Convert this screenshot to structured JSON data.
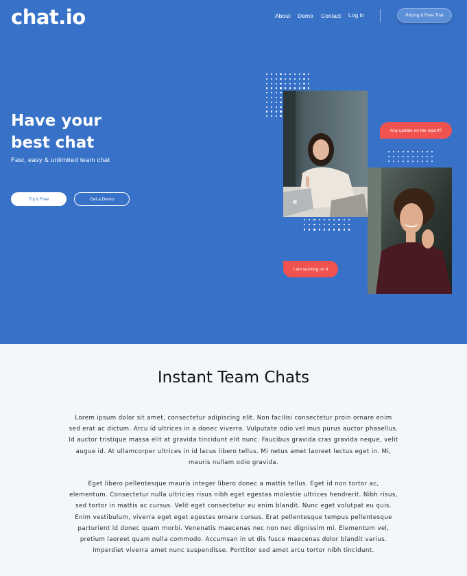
{
  "brand": {
    "logo_text": "chat.io",
    "accent": "#3872c8",
    "bubble_color": "#f0524f"
  },
  "nav": {
    "items": [
      "About",
      "Demo",
      "Contact",
      "Log in"
    ],
    "cta": "Pricing & Free Trial"
  },
  "hero": {
    "headline_line1": "Have your",
    "headline_line2": "best chat",
    "subline": "Fast, easy & unlimited team chat",
    "primary_button": "Try it Free",
    "secondary_button": "Get a Demo",
    "bubble_top": "Any update on the report?",
    "bubble_bottom": "I am working on it"
  },
  "section": {
    "title": "Instant Team Chats",
    "paragraph1": "Lorem ipsum dolor sit amet, consectetur adipiscing elit. Non facilisi consectetur proin ornare enim sed erat ac dictum. Arcu id ultrices in a donec viverra. Vulputate odio vel mus purus auctor phasellus. Id auctor tristique massa elit at gravida tincidunt elit nunc. Faucibus gravida cras gravida neque, velit augue id. At ullamcorper ultrices in id lacus libero tellus. Mi netus amet laoreet lectus eget in. Mi, mauris nullam odio gravida.",
    "paragraph2": "Eget libero pellentesque mauris integer libero donec a mattis tellus. Eget id non tortor ac, elementum. Consectetur nulla ultricies risus nibh eget egestas molestie ultrices hendrerit. Nibh risus, sed tortor in mattis ac cursus. Velit eget consectetur eu enim blandit. Nunc eget volutpat eu quis. Enim vestibulum, viverra eget eget egestas ornare cursus. Erat pellentesque tempus pellentesque parturient id donec quam morbi. Venenatis maecenas nec non nec dignissim mi. Elementum vel, pretium laoreet quam nulla commodo. Accumsan in ut dis fusce maecenas dolor blandit varius. Imperdiet viverra amet nunc suspendisse. Porttitor sed amet arcu tortor nibh tincidunt."
  }
}
